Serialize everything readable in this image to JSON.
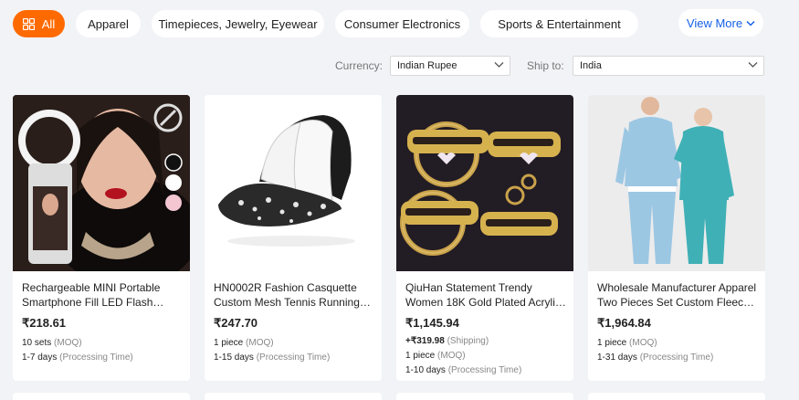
{
  "categories": {
    "all": "All",
    "apparel": "Apparel",
    "timepieces": "Timepieces, Jewelry, Eyewear",
    "electronics": "Consumer Electronics",
    "sports": "Sports & Entertainment",
    "view_more": "View More"
  },
  "filters": {
    "currency_label": "Currency:",
    "currency_value": "Indian Rupee",
    "ship_label": "Ship to:",
    "ship_value": "India"
  },
  "products": [
    {
      "title_line1": "Rechargeable MINI Portable",
      "title_line2": "Smartphone Fill LED Flash…",
      "price": "₹218.61",
      "moq_value": "10 sets",
      "moq_label": "(MOQ)",
      "processing_value": "1-7 days",
      "processing_label": "(Processing Time)",
      "image_icon": "ring-light-photo"
    },
    {
      "title_line1": "HN0002R Fashion Casquette",
      "title_line2": "Custom Mesh Tennis Running…",
      "price": "₹247.70",
      "moq_value": "1 piece",
      "moq_label": "(MOQ)",
      "processing_value": "1-15 days",
      "processing_label": "(Processing Time)",
      "image_icon": "cap-photo"
    },
    {
      "title_line1": "QiuHan Statement Trendy",
      "title_line2": "Women 18K Gold Plated Acryli…",
      "price": "₹1,145.94",
      "shipping_value": "+₹319.98",
      "shipping_label": "(Shipping)",
      "moq_value": "1 piece",
      "moq_label": "(MOQ)",
      "processing_value": "1-10 days",
      "processing_label": "(Processing Time)",
      "image_icon": "name-earrings-photo"
    },
    {
      "title_line1": "Wholesale Manufacturer Apparel",
      "title_line2": "Two Pieces Set Custom Fleec…",
      "price": "₹1,964.84",
      "moq_value": "1 piece",
      "moq_label": "(MOQ)",
      "processing_value": "1-31 days",
      "processing_label": "(Processing Time)",
      "image_icon": "tracksuit-photo"
    }
  ],
  "colors": {
    "accent": "#ff6a00",
    "link": "#1560e6",
    "background": "#f2f3f7"
  }
}
